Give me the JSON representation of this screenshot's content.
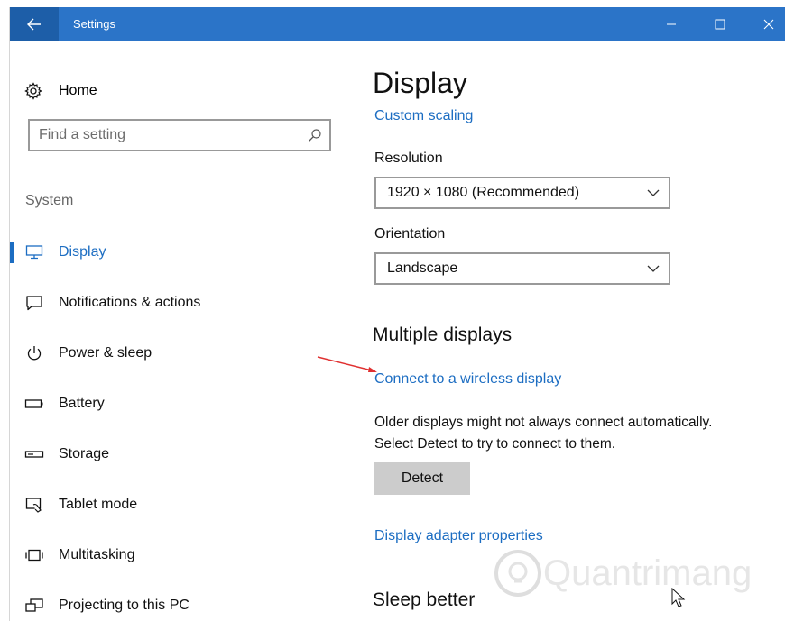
{
  "titlebar": {
    "title": "Settings"
  },
  "sidebar": {
    "home_label": "Home",
    "search_placeholder": "Find a setting",
    "section_label": "System",
    "items": [
      {
        "label": "Display",
        "icon": "monitor-icon",
        "active": true
      },
      {
        "label": "Notifications & actions",
        "icon": "message-icon"
      },
      {
        "label": "Power & sleep",
        "icon": "power-icon"
      },
      {
        "label": "Battery",
        "icon": "battery-icon"
      },
      {
        "label": "Storage",
        "icon": "storage-icon"
      },
      {
        "label": "Tablet mode",
        "icon": "tablet-icon"
      },
      {
        "label": "Multitasking",
        "icon": "multitasking-icon"
      },
      {
        "label": "Projecting to this PC",
        "icon": "projecting-icon"
      }
    ]
  },
  "main": {
    "title": "Display",
    "custom_scaling_link": "Custom scaling",
    "resolution_label": "Resolution",
    "resolution_value": "1920 × 1080 (Recommended)",
    "orientation_label": "Orientation",
    "orientation_value": "Landscape",
    "multiple_displays_title": "Multiple displays",
    "wireless_link": "Connect to a wireless display",
    "detect_desc_line1": "Older displays might not always connect automatically.",
    "detect_desc_line2": "Select Detect to try to connect to them.",
    "detect_button": "Detect",
    "adapter_link": "Display adapter properties",
    "sleep_title": "Sleep better"
  },
  "watermark": {
    "text": "Quantrimang"
  },
  "colors": {
    "titlebar": "#2b74c8",
    "accent": "#1c6dc2",
    "annotation_arrow": "#e03030"
  }
}
